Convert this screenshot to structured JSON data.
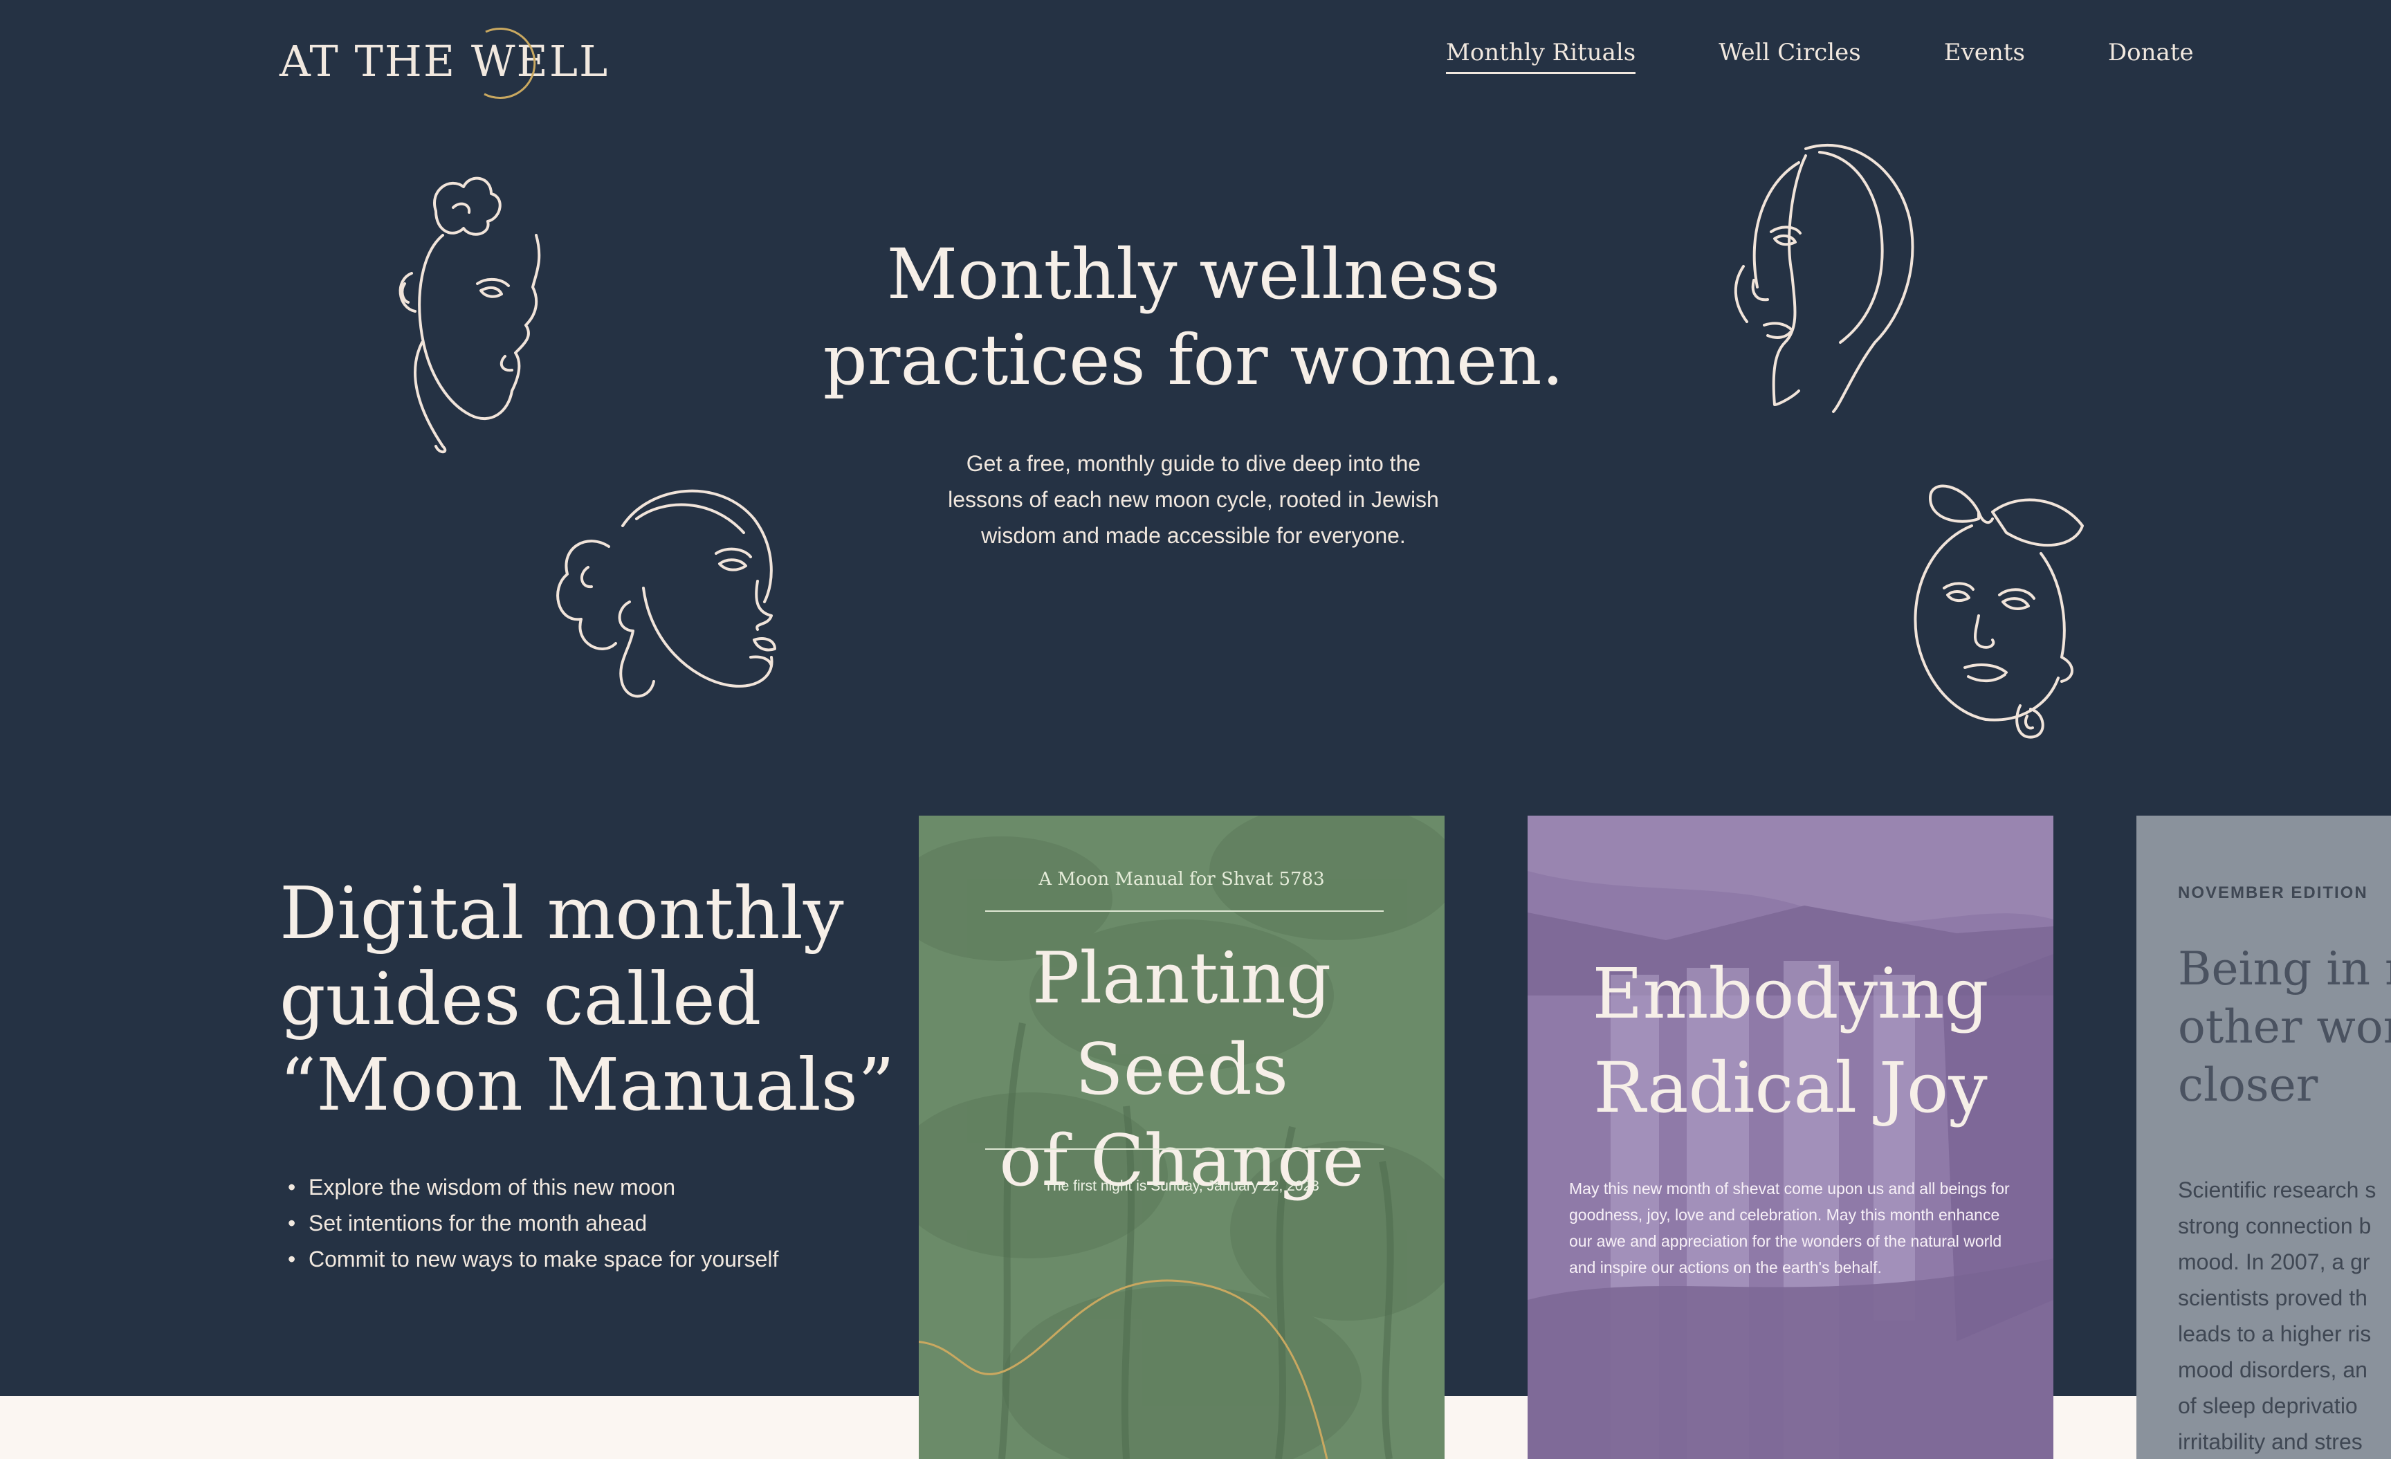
{
  "header": {
    "logo_text": "AT THE WELL",
    "nav": [
      {
        "label": "Monthly Rituals",
        "active": true
      },
      {
        "label": "Well Circles",
        "active": false
      },
      {
        "label": "Events",
        "active": false
      },
      {
        "label": "Donate",
        "active": false
      }
    ]
  },
  "hero": {
    "title_line1": "Monthly wellness",
    "title_line2": "practices for women.",
    "subtitle_line1": "Get a free, monthly guide to dive deep into the",
    "subtitle_line2": "lessons of each new moon cycle, rooted in Jewish",
    "subtitle_line3": "wisdom and made accessible for everyone."
  },
  "manuals": {
    "title_line1": "Digital monthly",
    "title_line2": "guides called",
    "title_line3": "“Moon Manuals”",
    "bullets": [
      "Explore the wisdom of this new moon",
      "Set intentions for the month ahead",
      "Commit to new ways to make space for yourself"
    ]
  },
  "cards": {
    "green": {
      "kicker": "A Moon Manual for Shvat 5783",
      "title_line1": "Planting Seeds",
      "title_line2": "of Change",
      "date": "The first night is Sunday, January 22, 2023",
      "color": "#6b8b69"
    },
    "purple": {
      "title_line1": "Embodying",
      "title_line2": "Radical Joy",
      "body": "May this new month of shevat come upon us and all beings for goodness, joy, love and celebration. May this month enhance our awe and appreciation for the wonders of the natural world and inspire our actions on the earth's behalf.",
      "color": "#8f7aa8"
    },
    "grey": {
      "edition": "NOVEMBER EDITION",
      "title": "Being in na\nother wome\ncloser",
      "body": "Scientific research s\nstrong connection b\nmood. In 2007, a gr\nscientists proved th\nleads to a higher ris\nmood disorders, an\nof sleep deprivatio\nirritability and stres",
      "color": "#8a929c"
    }
  },
  "colors": {
    "background": "#253244",
    "cream": "#fbf6f2",
    "line_art": "#f1e4da",
    "gold": "#c9a860"
  }
}
